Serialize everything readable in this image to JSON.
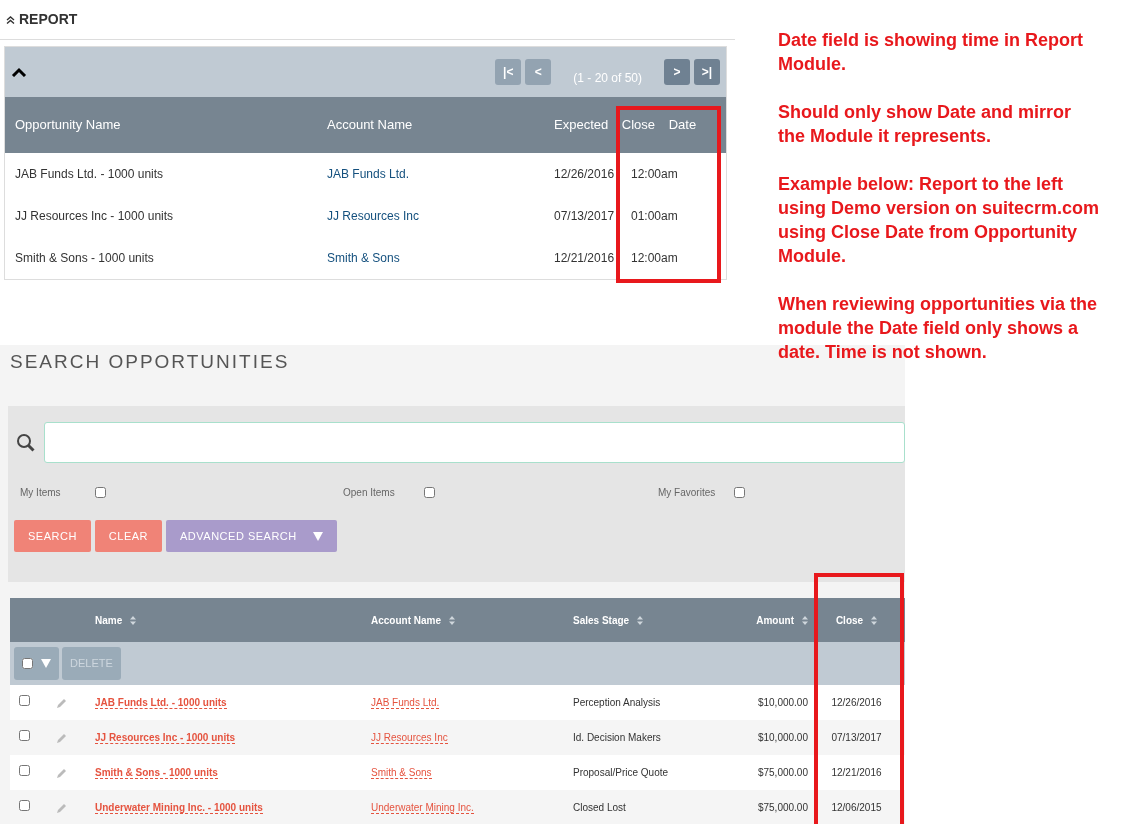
{
  "report": {
    "title": "REPORT",
    "pager": {
      "label": "(1 - 20 of 50)",
      "buttons": [
        {
          "label": "|<",
          "disabled": true
        },
        {
          "label": "<",
          "disabled": true
        },
        {
          "label": ">",
          "disabled": false
        },
        {
          "label": ">|",
          "disabled": false
        }
      ]
    },
    "columns": [
      "Opportunity Name",
      "Account Name",
      "Expected Close Date"
    ],
    "rows": [
      {
        "opportunity": "JAB Funds Ltd. - 1000 units",
        "account": "JAB Funds Ltd.",
        "close_date": "12/26/2016",
        "close_time": "12:00am"
      },
      {
        "opportunity": "JJ Resources Inc - 1000 units",
        "account": "JJ Resources Inc",
        "close_date": "07/13/2017",
        "close_time": "01:00am"
      },
      {
        "opportunity": "Smith & Sons - 1000 units",
        "account": "Smith & Sons",
        "close_date": "12/21/2016",
        "close_time": "12:00am"
      }
    ]
  },
  "annotation": [
    "Date field is showing time in Report Module.",
    "Should only show Date and mirror the Module it represents.",
    "Example below:  Report to the left using Demo version on suitecrm.com using Close Date from Opportunity Module.",
    "When reviewing opportunities via the module the Date field only shows a date.  Time is not shown."
  ],
  "search": {
    "title": "SEARCH OPPORTUNITIES",
    "filters": [
      {
        "label": "My Items",
        "checked": false
      },
      {
        "label": "Open Items",
        "checked": false
      },
      {
        "label": "My Favorites",
        "checked": false
      }
    ],
    "buttons": [
      {
        "label": "SEARCH",
        "kind": "primary"
      },
      {
        "label": "CLEAR",
        "kind": "primary"
      },
      {
        "label": "ADVANCED SEARCH",
        "kind": "dropdown"
      }
    ],
    "columns": [
      "Name",
      "Account Name",
      "Sales Stage",
      "Amount",
      "Close"
    ],
    "select_all_checked": false,
    "bulk_action": "DELETE",
    "rows": [
      {
        "name": "JAB Funds Ltd. - 1000 units",
        "account": "JAB Funds Ltd.",
        "stage": "Perception Analysis",
        "amount": "$10,000.00",
        "close": "12/26/2016",
        "checked": false
      },
      {
        "name": "JJ Resources Inc - 1000 units",
        "account": "JJ Resources Inc",
        "stage": "Id. Decision Makers",
        "amount": "$10,000.00",
        "close": "07/13/2017",
        "checked": false
      },
      {
        "name": "Smith & Sons - 1000 units",
        "account": "Smith & Sons",
        "stage": "Proposal/Price Quote",
        "amount": "$75,000.00",
        "close": "12/21/2016",
        "checked": false
      },
      {
        "name": "Underwater Mining Inc. - 1000 units",
        "account": "Underwater Mining Inc.",
        "stage": "Closed Lost",
        "amount": "$75,000.00",
        "close": "12/06/2015",
        "checked": false
      }
    ]
  }
}
